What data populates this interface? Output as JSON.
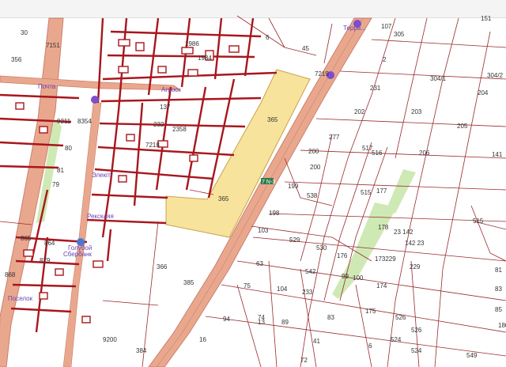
{
  "map": {
    "road_label": "7 N-3",
    "colors": {
      "road": "#e9a88e",
      "road_edge": "#c9806d",
      "highlight_parcel": "#f7e39c",
      "green_strip": "#cfe9b5",
      "dark_lines": "#a8161d",
      "thin_lines": "#9a2a2f",
      "icon": "#7c4dcc"
    },
    "places": [
      {
        "text": "Терра..."
      },
      {
        "text": "Агроск"
      },
      {
        "text": "Почта"
      },
      {
        "text": "Элекгп"
      },
      {
        "text": "Рекскаяя"
      },
      {
        "text": "Голубой"
      },
      {
        "text": "Сбербанк"
      },
      {
        "text": "Поселок"
      }
    ],
    "parcels": [
      "7151",
      "356",
      "9311",
      "8354",
      "1984",
      "1986",
      "137",
      "232",
      "2358",
      "7218",
      "45",
      "6",
      "2",
      "304/1",
      "304/2",
      "231",
      "202",
      "203",
      "204",
      "205",
      "206",
      "141",
      "7219",
      "277",
      "517",
      "516",
      "200",
      "200",
      "199",
      "538",
      "515",
      "177",
      "198",
      "103",
      "529",
      "530",
      "176",
      "178",
      "23 142",
      "142 23",
      "173229",
      "229",
      "542",
      "99",
      "100",
      "174",
      "365",
      "365",
      "366",
      "385",
      "865",
      "864",
      "879",
      "868",
      "9200",
      "384",
      "63",
      "75",
      "74",
      "94",
      "104",
      "233",
      "89",
      "83",
      "41",
      "72",
      "13",
      "16",
      "175",
      "526",
      "524",
      "524",
      "526",
      "6",
      "549",
      "81",
      "83",
      "85",
      "180",
      "515",
      "30",
      "80",
      "79",
      "81",
      "151",
      "107",
      "305"
    ]
  }
}
